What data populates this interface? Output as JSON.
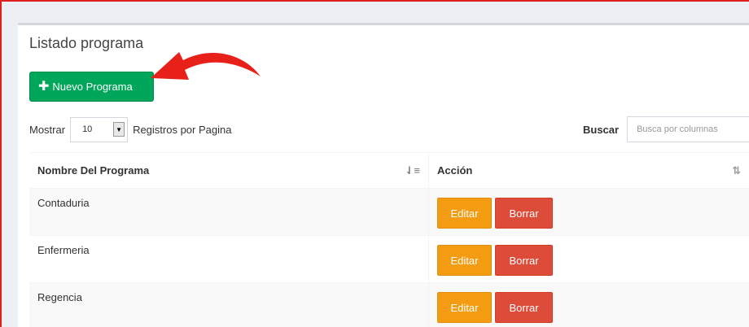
{
  "box": {
    "title": "Listado programa"
  },
  "toolbar": {
    "new_label": "Nuevo Programa",
    "new_icon": "plus-icon"
  },
  "length": {
    "prefix": "Mostrar",
    "value": "10",
    "suffix": "Registros por Pagina"
  },
  "search": {
    "label": "Buscar",
    "placeholder": "Busca por columnas"
  },
  "table": {
    "headers": [
      "Nombre Del Programa",
      "Acción"
    ],
    "rows": [
      {
        "name": "Contaduria",
        "edit": "Editar",
        "delete": "Borrar"
      },
      {
        "name": "Enfermeria",
        "edit": "Editar",
        "delete": "Borrar"
      },
      {
        "name": "Regencia",
        "edit": "Editar",
        "delete": "Borrar"
      }
    ]
  },
  "colors": {
    "primary_green": "#00a65a",
    "edit_orange": "#f39c12",
    "delete_red": "#dd4b39",
    "annotation_arrow": "#e8201a"
  }
}
